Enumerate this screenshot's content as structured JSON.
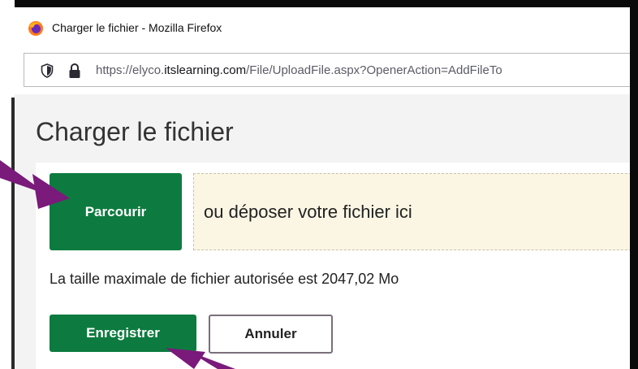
{
  "window": {
    "title": "Charger le fichier - Mozilla Firefox"
  },
  "address_bar": {
    "url_prefix": "https://elyco.",
    "url_domain": "itslearning.com",
    "url_suffix": "/File/UploadFile.aspx?OpenerAction=AddFileTo"
  },
  "page": {
    "title": "Charger le fichier",
    "browse_label": "Parcourir",
    "drop_zone_text": "ou déposer votre fichier ici",
    "max_size_text": "La taille maximale de fichier autorisée est 2047,02 Mo",
    "save_label": "Enregistrer",
    "cancel_label": "Annuler"
  },
  "colors": {
    "primary_green": "#0d7b3f",
    "drop_zone_bg": "#fbf6e4",
    "annotation_arrow": "#7a1a7a",
    "page_bg": "#f3f3f3"
  },
  "icons": {
    "browser": "firefox-logo-icon",
    "tracking": "shield-icon",
    "security": "lock-icon"
  },
  "annotations": {
    "arrows": [
      "arrow-to-browse-button",
      "arrow-to-save-button"
    ]
  }
}
